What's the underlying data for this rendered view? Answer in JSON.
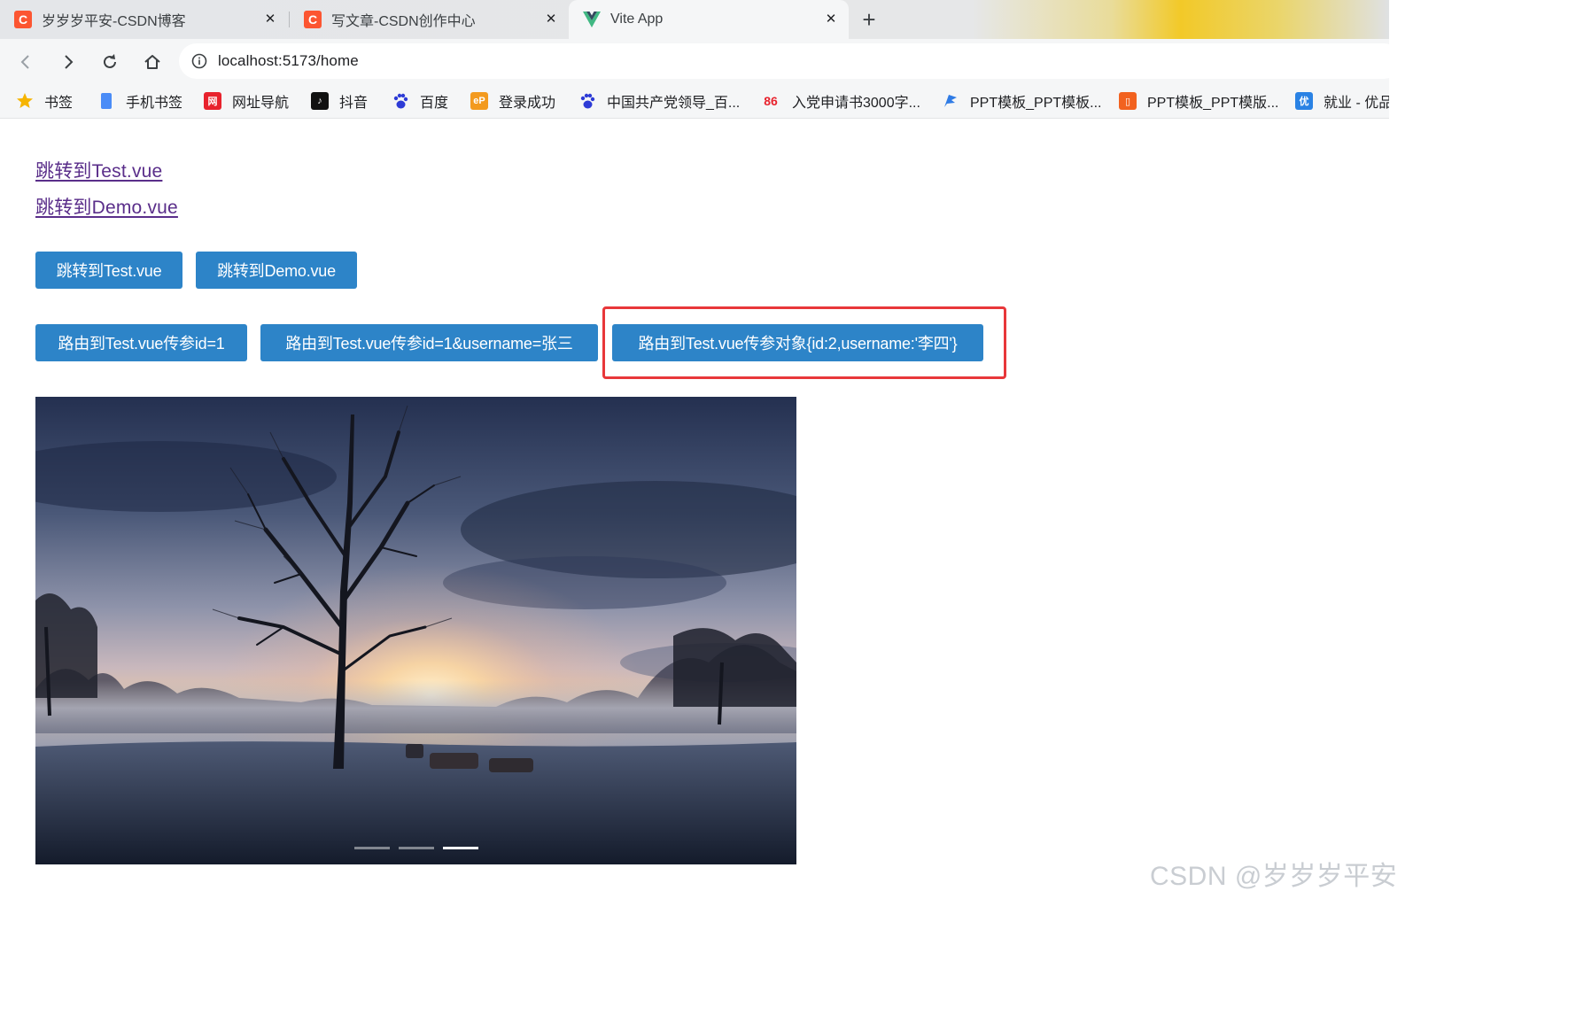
{
  "browser": {
    "tabs": [
      {
        "title": "岁岁岁平安-CSDN博客",
        "favicon": "csdn-icon",
        "active": false
      },
      {
        "title": "写文章-CSDN创作中心",
        "favicon": "csdn-icon",
        "active": false
      },
      {
        "title": "Vite App",
        "favicon": "vue-icon",
        "active": true
      }
    ],
    "new_tab_label": "+",
    "close_glyph": "✕",
    "address": "localhost:5173/home",
    "bookmarks": [
      {
        "label": "书签",
        "icon": "star-icon"
      },
      {
        "label": "手机书签",
        "icon": "phone-icon"
      },
      {
        "label": "网址导航",
        "icon": "nav-icon"
      },
      {
        "label": "抖音",
        "icon": "douyin-icon"
      },
      {
        "label": "百度",
        "icon": "baidu-icon"
      },
      {
        "label": "登录成功",
        "icon": "ep-icon"
      },
      {
        "label": "中国共产党领导_百...",
        "icon": "baidu-icon"
      },
      {
        "label": "入党申请书3000字...",
        "icon": "86-icon"
      },
      {
        "label": "PPT模板_PPT模板...",
        "icon": "ppt-icon"
      },
      {
        "label": "PPT模板_PPT模版...",
        "icon": "ppt-orange-icon"
      },
      {
        "label": "就业 - 优品",
        "icon": "youpin-icon"
      }
    ]
  },
  "page": {
    "links": [
      "跳转到Test.vue",
      "跳转到Demo.vue"
    ],
    "buttons_row1": [
      "跳转到Test.vue",
      "跳转到Demo.vue"
    ],
    "buttons_row2": [
      "路由到Test.vue传参id=1",
      "路由到Test.vue传参id=1&username=张三",
      "路由到Test.vue传参对象{id:2,username:'李四'}"
    ],
    "carousel": {
      "slide_count": 3,
      "active_slide": 3
    }
  },
  "watermark": "CSDN @岁岁岁平安",
  "colors": {
    "button": "#2d84c8",
    "highlight": "#e8373a",
    "link": "#5a2e8a"
  }
}
